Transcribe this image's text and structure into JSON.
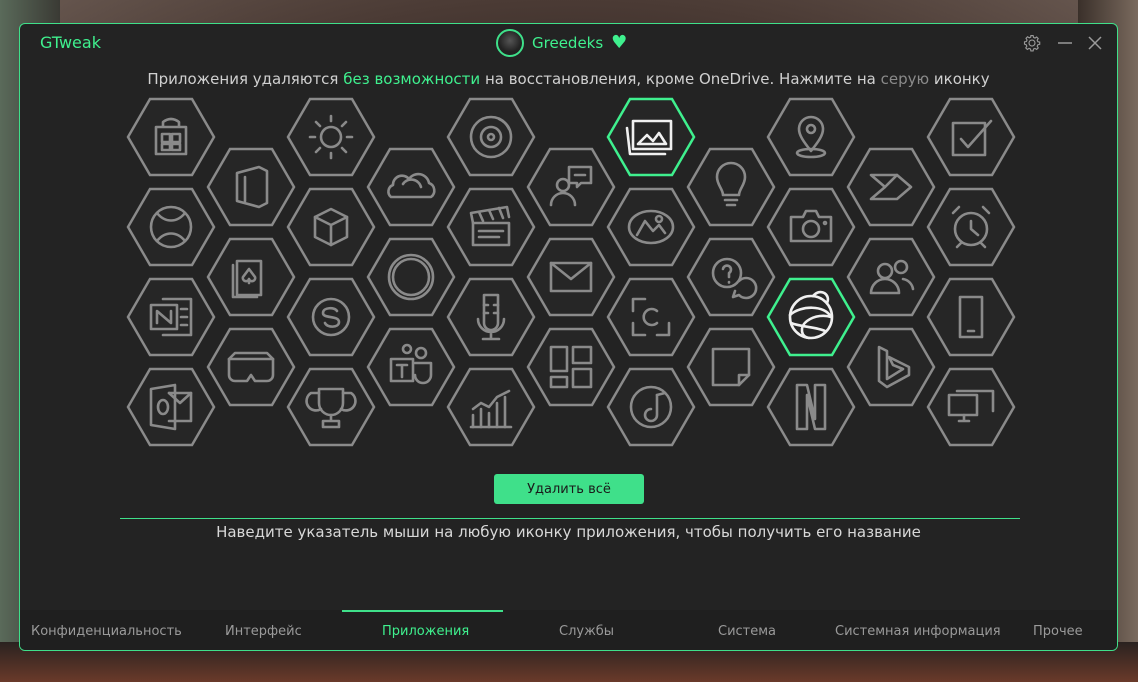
{
  "window": {
    "title": "GTweak"
  },
  "user": {
    "name": "Greedeks"
  },
  "info": {
    "part1": "Приложения удаляются ",
    "highlight": "без возможности",
    "part2": " на восстановления, кроме OneDrive. Нажмите на ",
    "gray_word": "серую",
    "part3": " иконку"
  },
  "apps": [
    {
      "icon": "store-icon",
      "selected": false
    },
    {
      "icon": "weather-icon",
      "selected": false
    },
    {
      "icon": "disc-icon",
      "selected": false
    },
    {
      "icon": "photos-icon",
      "selected": true
    },
    {
      "icon": "maps-icon",
      "selected": false
    },
    {
      "icon": "todo-icon",
      "selected": false
    },
    {
      "icon": "office-icon",
      "selected": false
    },
    {
      "icon": "onedrive-icon",
      "selected": false
    },
    {
      "icon": "feedback-icon",
      "selected": false
    },
    {
      "icon": "tips-icon",
      "selected": false
    },
    {
      "icon": "power-automate-icon",
      "selected": false
    },
    {
      "icon": "xbox-icon",
      "selected": false
    },
    {
      "icon": "3d-viewer-icon",
      "selected": false
    },
    {
      "icon": "clipchamp-icon",
      "selected": false
    },
    {
      "icon": "paint-3d-icon",
      "selected": false
    },
    {
      "icon": "camera-icon",
      "selected": false
    },
    {
      "icon": "alarms-icon",
      "selected": false
    },
    {
      "icon": "solitaire-icon",
      "selected": false
    },
    {
      "icon": "cortana-icon",
      "selected": false
    },
    {
      "icon": "mail-icon",
      "selected": false
    },
    {
      "icon": "get-help-icon",
      "selected": false
    },
    {
      "icon": "people-icon",
      "selected": false
    },
    {
      "icon": "onenote-icon",
      "selected": false
    },
    {
      "icon": "skype-icon",
      "selected": false
    },
    {
      "icon": "voice-recorder-icon",
      "selected": false
    },
    {
      "icon": "snipping-tool-icon",
      "selected": false
    },
    {
      "icon": "edge-icon",
      "selected": true
    },
    {
      "icon": "your-phone-icon",
      "selected": false
    },
    {
      "icon": "vr-headset-icon",
      "selected": false
    },
    {
      "icon": "teams-icon",
      "selected": false
    },
    {
      "icon": "widgets-icon",
      "selected": false
    },
    {
      "icon": "sticky-notes-icon",
      "selected": false
    },
    {
      "icon": "bing-icon",
      "selected": false
    },
    {
      "icon": "outlook-icon",
      "selected": false
    },
    {
      "icon": "trophy-icon",
      "selected": false
    },
    {
      "icon": "finance-chart-icon",
      "selected": false
    },
    {
      "icon": "groove-music-icon",
      "selected": false
    },
    {
      "icon": "netflix-icon",
      "selected": false
    },
    {
      "icon": "quick-assist-icon",
      "selected": false
    }
  ],
  "actions": {
    "delete_all": "Удалить всё"
  },
  "hint": "Наведите указатель мыши на любую иконку приложения, чтобы получить его название",
  "nav": [
    {
      "label": "Конфиденциальность",
      "active": false
    },
    {
      "label": "Интерфейс",
      "active": false
    },
    {
      "label": "Приложения",
      "active": true
    },
    {
      "label": "Службы",
      "active": false
    },
    {
      "label": "Система",
      "active": false
    },
    {
      "label": "Системная информация",
      "active": false
    },
    {
      "label": "Прочее",
      "active": false
    }
  ],
  "colors": {
    "accent": "#3fe08a",
    "hex_outline": "#8a8a8a",
    "window_bg": "#232323"
  }
}
